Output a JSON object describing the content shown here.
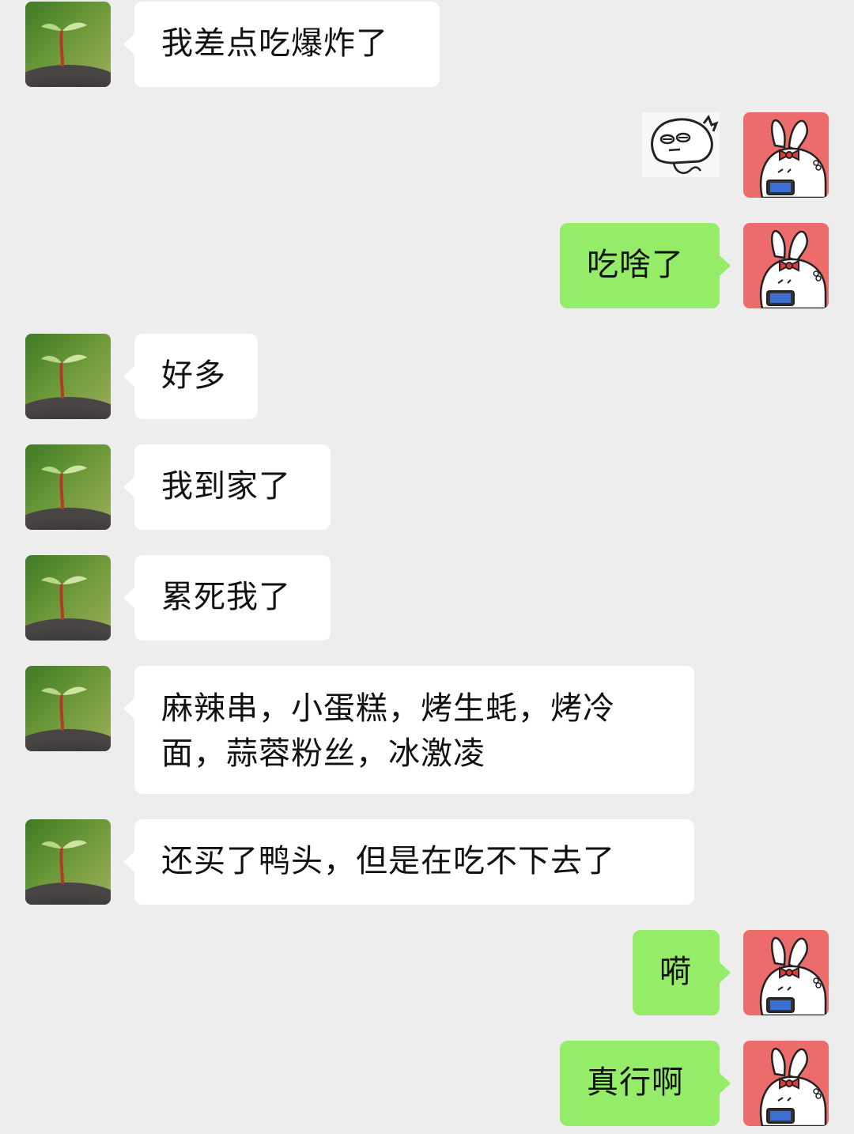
{
  "colors": {
    "background": "#ededed",
    "incoming_bubble": "#ffffff",
    "outgoing_bubble": "#95ec69",
    "self_avatar_bg": "#ec6b6b"
  },
  "contact_avatar_icon": "sprout-avatar-icon",
  "self_avatar_icon": "bunny-bow-avatar-icon",
  "messages": [
    {
      "side": "in",
      "text": "我差点吃爆炸了"
    },
    {
      "side": "out",
      "type": "sticker",
      "sticker_icon": "grumpy-face-sticker"
    },
    {
      "side": "out",
      "text": "吃啥了"
    },
    {
      "side": "in",
      "text": "好多"
    },
    {
      "side": "in",
      "text": "我到家了"
    },
    {
      "side": "in",
      "text": "累死我了"
    },
    {
      "side": "in",
      "lines": [
        "麻辣串，小蛋糕，烤生蚝，烤冷",
        "面，蒜蓉粉丝，冰激凌"
      ]
    },
    {
      "side": "in",
      "text": "还买了鸭头，但是在吃不下去了"
    },
    {
      "side": "out",
      "text": "嗬"
    },
    {
      "side": "out",
      "text": "真行啊"
    }
  ]
}
